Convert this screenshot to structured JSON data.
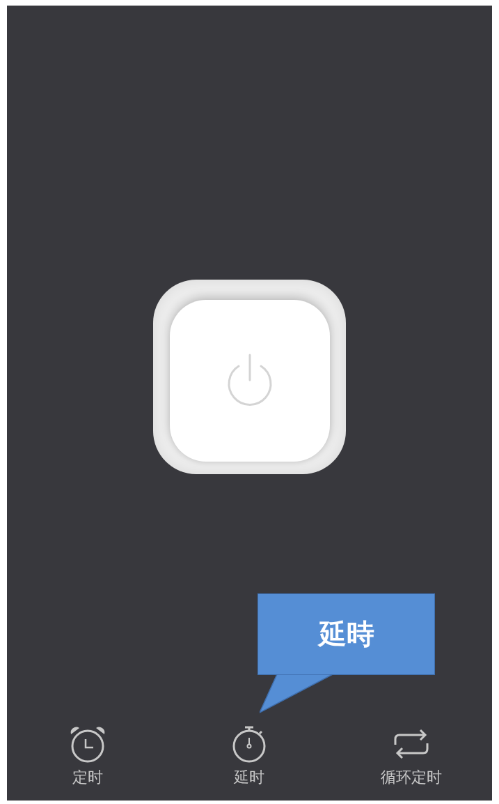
{
  "power_button": {
    "kind": "power"
  },
  "callout": {
    "text": "延時"
  },
  "tabs": [
    {
      "label": "定时",
      "kind": "alarm"
    },
    {
      "label": "延时",
      "kind": "stopwatch"
    },
    {
      "label": "循环定时",
      "kind": "repeat"
    }
  ]
}
